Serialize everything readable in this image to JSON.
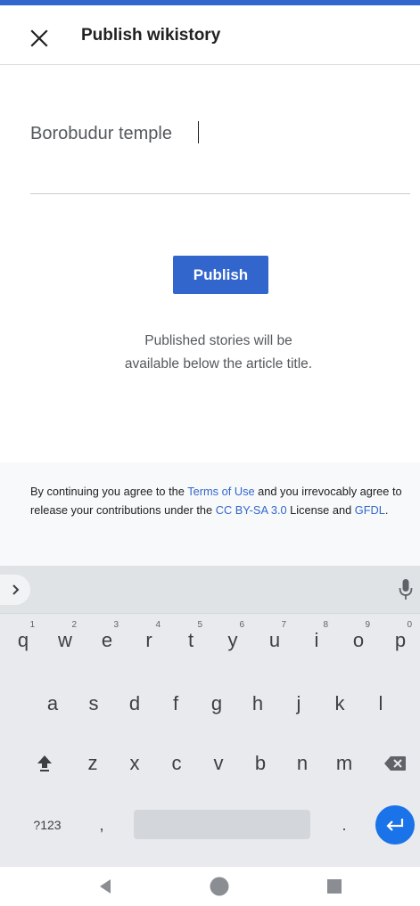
{
  "header": {
    "title": "Publish wikistory"
  },
  "title_field": {
    "value": "Borobudur temple"
  },
  "publish": {
    "label": "Publish",
    "note_line1": "Published stories will be",
    "note_line2": "available below the article title."
  },
  "license": {
    "part1": "By continuing you agree to the ",
    "terms_link": "Terms of Use",
    "part2": " and you irrevocably agree to release your contributions under the ",
    "cc_link": "CC BY-SA 3.0",
    "part3": " License and ",
    "gfdl_link": "GFDL",
    "part4": "."
  },
  "keyboard": {
    "row1": [
      {
        "key": "q",
        "hint": "1"
      },
      {
        "key": "w",
        "hint": "2"
      },
      {
        "key": "e",
        "hint": "3"
      },
      {
        "key": "r",
        "hint": "4"
      },
      {
        "key": "t",
        "hint": "5"
      },
      {
        "key": "y",
        "hint": "6"
      },
      {
        "key": "u",
        "hint": "7"
      },
      {
        "key": "i",
        "hint": "8"
      },
      {
        "key": "o",
        "hint": "9"
      },
      {
        "key": "p",
        "hint": "0"
      }
    ],
    "row2": [
      "a",
      "s",
      "d",
      "f",
      "g",
      "h",
      "j",
      "k",
      "l"
    ],
    "row3": [
      "z",
      "x",
      "c",
      "v",
      "b",
      "n",
      "m"
    ],
    "symbols_label": "?123",
    "comma": ",",
    "period": "."
  },
  "colors": {
    "accent": "#3366cc",
    "enter_key": "#1a73e8",
    "keyboard_bg": "#e8eaed",
    "license_bg": "#f8f9fa"
  },
  "icons": {
    "close": "close-icon",
    "expand": "chevron-right-icon",
    "mic": "microphone-icon",
    "shift": "shift-icon",
    "backspace": "backspace-icon",
    "enter": "enter-icon",
    "back": "back-triangle-icon",
    "home": "home-circle-icon",
    "recents": "recents-square-icon"
  }
}
